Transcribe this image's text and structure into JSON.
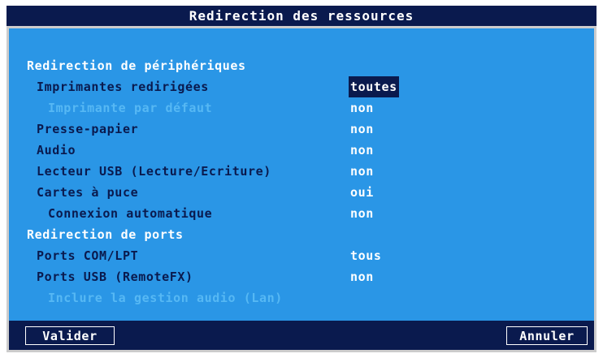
{
  "window": {
    "title": "Redirection des ressources"
  },
  "sections": {
    "peripherals": "Redirection de périphériques",
    "ports": "Redirection de ports"
  },
  "rows": [
    {
      "label": "Imprimantes redirigées",
      "value": "toutes"
    },
    {
      "label": "Imprimante par défaut",
      "value": "non"
    },
    {
      "label": "Presse-papier",
      "value": "non"
    },
    {
      "label": "Audio",
      "value": "non"
    },
    {
      "label": "Lecteur USB (Lecture/Ecriture)",
      "value": "non"
    },
    {
      "label": "Cartes à puce",
      "value": "oui"
    },
    {
      "label": "Connexion automatique",
      "value": "non"
    },
    {
      "label": "Ports COM/LPT",
      "value": "tous"
    },
    {
      "label": "Ports USB (RemoteFX)",
      "value": "non"
    },
    {
      "label": "Inclure la gestion audio (Lan)",
      "value": ""
    }
  ],
  "buttons": {
    "ok": "Valider",
    "cancel": "Annuler"
  },
  "colors": {
    "background": "#2a96e6",
    "accent": "#0a1a4e",
    "dimmed": "#56b8f4"
  }
}
